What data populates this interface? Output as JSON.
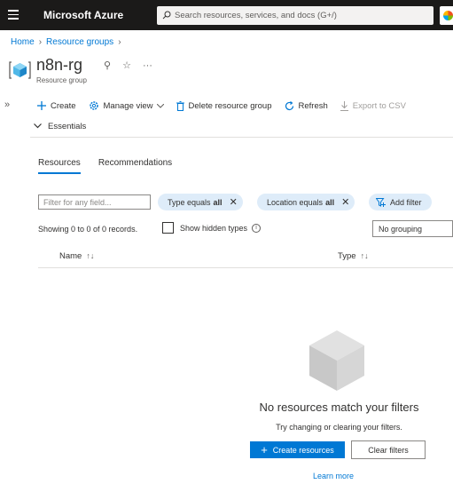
{
  "topbar": {
    "brand": "Microsoft Azure",
    "search_placeholder": "Search resources, services, and docs (G+/)",
    "icons": [
      "hamburger-icon",
      "search-icon",
      "cloud-shell-icon"
    ]
  },
  "breadcrumb": {
    "items": [
      "Home",
      "Resource groups"
    ]
  },
  "header": {
    "title": "n8n-rg",
    "subtitle": "Resource group",
    "pin_glyph": "⚲",
    "star_glyph": "☆",
    "more_glyph": "···"
  },
  "commands": {
    "expand_glyph": "»",
    "create": "Create",
    "manage_view": "Manage view",
    "delete": "Delete resource group",
    "refresh": "Refresh",
    "export": "Export to CSV"
  },
  "essentials": {
    "label": "Essentials"
  },
  "tabs": [
    {
      "label": "Resources",
      "active": true
    },
    {
      "label": "Recommendations",
      "active": false
    }
  ],
  "filters": {
    "input_placeholder": "Filter for any field...",
    "type_prefix": "Type equals",
    "type_value": "all",
    "location_prefix": "Location equals",
    "location_value": "all",
    "add_filter": "Add filter",
    "remove_glyph": "✕"
  },
  "list": {
    "records_text": "Showing 0 to 0 of 0 records.",
    "show_hidden_types": "Show hidden types",
    "grouping": "No grouping",
    "columns": [
      {
        "label": "Name",
        "sort_glyph": "↑↓"
      },
      {
        "label": "Type",
        "sort_glyph": "↑↓"
      }
    ]
  },
  "empty_state": {
    "title": "No resources match your filters",
    "subtitle": "Try changing or clearing your filters.",
    "create_button": "Create resources",
    "clear_button": "Clear filters",
    "learn_more": "Learn more"
  },
  "colors": {
    "topbar_bg": "#1b1a19",
    "accent": "#0078d4",
    "pill_bg": "#deecf9"
  }
}
